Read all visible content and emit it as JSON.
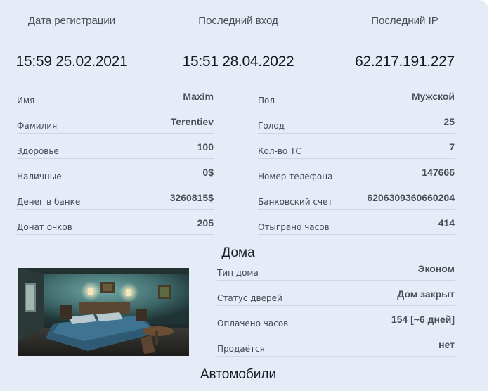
{
  "stats": {
    "headers": [
      "Дата регистрации",
      "Последний вход",
      "Последний IP"
    ],
    "values": [
      "15:59 25.02.2021",
      "15:51 28.04.2022",
      "62.217.191.227"
    ]
  },
  "info_left": [
    {
      "label": "Имя",
      "value": "Maxim"
    },
    {
      "label": "Фамилия",
      "value": "Terentiev"
    },
    {
      "label": "Здоровье",
      "value": "100"
    },
    {
      "label": "Наличные",
      "value": "0$"
    },
    {
      "label": "Денег в банке",
      "value": "3260815$"
    },
    {
      "label": "Донат очков",
      "value": "205"
    }
  ],
  "info_right": [
    {
      "label": "Пол",
      "value": "Мужской"
    },
    {
      "label": "Голод",
      "value": "25"
    },
    {
      "label": "Кол-во ТС",
      "value": "7"
    },
    {
      "label": "Номер телефона",
      "value": "147666"
    },
    {
      "label": "Банковский счет",
      "value": "6206309360660204"
    },
    {
      "label": "Отыграно часов",
      "value": "414"
    }
  ],
  "houses": {
    "title": "Дома",
    "rows": [
      {
        "label": "Тип дома",
        "value": "Эконом"
      },
      {
        "label": "Статус дверей",
        "value": "Дом закрыт"
      },
      {
        "label": "Оплачено часов",
        "value": "154 [~6 дней]"
      },
      {
        "label": "Продаётся",
        "value": "нет"
      }
    ]
  },
  "cars": {
    "title": "Автомобили"
  },
  "colors": {
    "panel": "#e5ebf7",
    "text": "#16181c",
    "muted": "#4b4f55"
  }
}
